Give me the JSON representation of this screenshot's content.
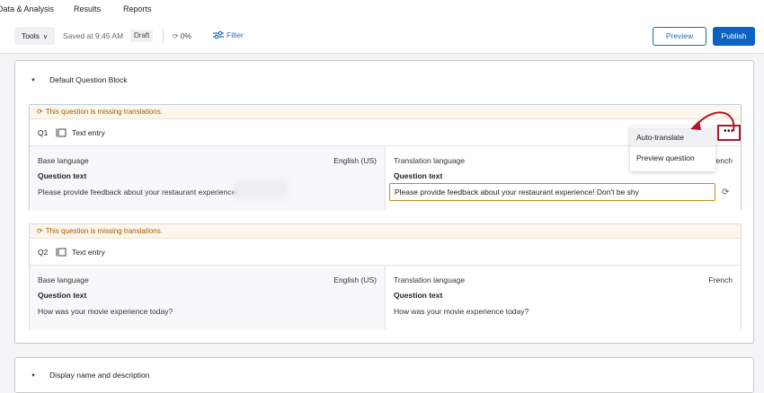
{
  "nav": {
    "tabs": [
      "Data & Analysis",
      "Results",
      "Reports"
    ]
  },
  "toolbar": {
    "tools_label": "Tools",
    "saved_text": "Saved at 9:45 AM",
    "draft_badge": "Draft",
    "progress_text": "0%",
    "filter_label": "Filter",
    "preview_label": "Preview",
    "publish_label": "Publish"
  },
  "blocks": [
    {
      "title": "Default Question Block"
    },
    {
      "title": "Display name and description"
    }
  ],
  "questions": [
    {
      "warning": "This question is missing translations.",
      "number": "Q1",
      "type": "Text entry",
      "base_language_label": "Base language",
      "base_language": "English (US)",
      "question_text_label": "Question text",
      "base_text": "Please provide feedback about your restaurant experience!",
      "translation_language_label": "Translation language",
      "translation_language": "French",
      "translation_question_text_label": "Question text",
      "translation_text": "Please provide feedback about your restaurant experience! Don't be shy"
    },
    {
      "warning": "This question is missing translations.",
      "number": "Q2",
      "type": "Text entry",
      "base_language_label": "Base language",
      "base_language": "English (US)",
      "question_text_label": "Question text",
      "base_text": "How was your movie experience today?",
      "translation_language_label": "Translation language",
      "translation_language": "French",
      "translation_question_text_label": "Question text",
      "translation_text": "How was your movie experience today?"
    }
  ],
  "more_menu": {
    "button_glyph": "•••",
    "items": [
      "Auto-translate",
      "Preview question"
    ]
  },
  "colors": {
    "accent": "#0b62c4",
    "warning_text": "#a45a00",
    "highlight": "#b0162a"
  }
}
